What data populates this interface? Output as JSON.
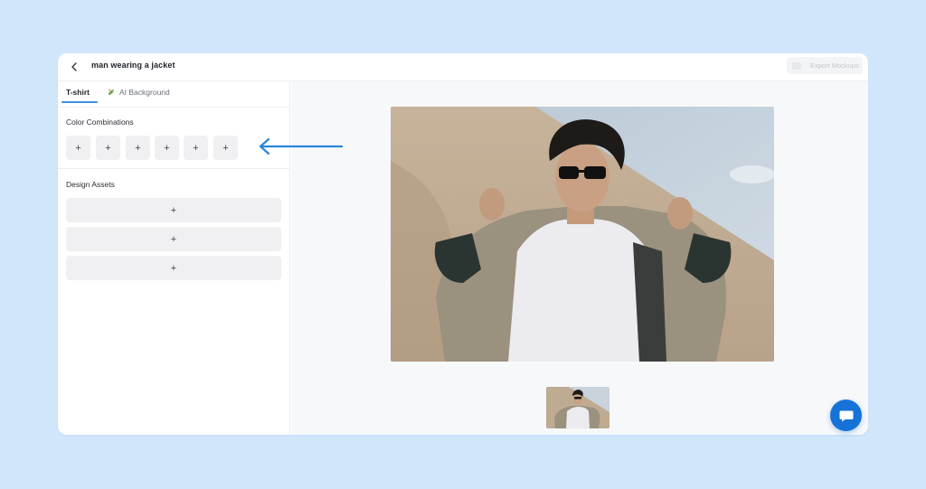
{
  "header": {
    "back_icon": "chevron-left-icon",
    "title": "man wearing a jacket",
    "export_label": "Export Mockups"
  },
  "tabs": [
    {
      "label": "T-shirt",
      "active": true
    },
    {
      "label": "AI Background",
      "icon": "leaf-sparkle-icon",
      "active": false
    }
  ],
  "sidebar": {
    "color_combinations_label": "Color Combinations",
    "color_slots": [
      "+",
      "+",
      "+",
      "+",
      "+",
      "+"
    ],
    "design_assets_label": "Design Assets",
    "asset_slots": [
      "+",
      "+",
      "+"
    ]
  },
  "canvas": {
    "main_image": "man-wearing-jacket-photo",
    "thumbnail_count": 1
  },
  "chat": {
    "icon": "chat-bubble-icon"
  },
  "annotation": {
    "icon": "arrow-left-icon",
    "color": "#2a86d9"
  },
  "colors": {
    "page_background": "#cfe6fb",
    "accent": "#3b8fe0",
    "chat_button": "#1672d8",
    "slot_background": "#f0f0f2"
  }
}
